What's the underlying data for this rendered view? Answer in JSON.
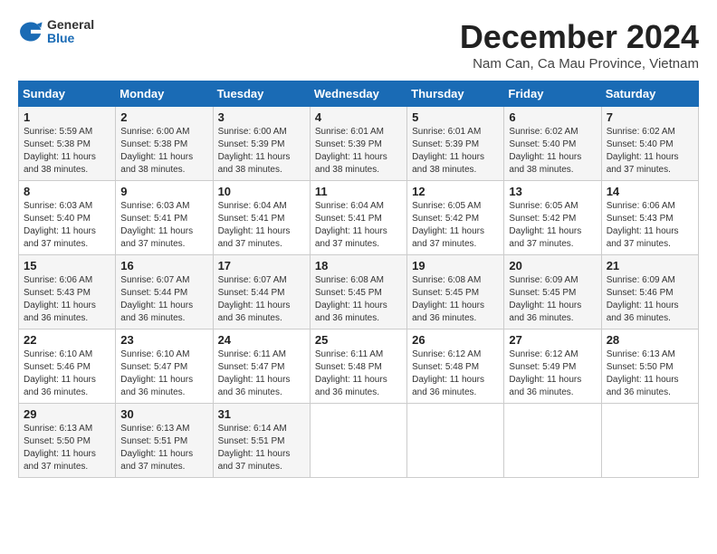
{
  "logo": {
    "general": "General",
    "blue": "Blue"
  },
  "title": "December 2024",
  "location": "Nam Can, Ca Mau Province, Vietnam",
  "headers": [
    "Sunday",
    "Monday",
    "Tuesday",
    "Wednesday",
    "Thursday",
    "Friday",
    "Saturday"
  ],
  "weeks": [
    [
      {
        "day": "1",
        "detail": "Sunrise: 5:59 AM\nSunset: 5:38 PM\nDaylight: 11 hours\nand 38 minutes."
      },
      {
        "day": "2",
        "detail": "Sunrise: 6:00 AM\nSunset: 5:38 PM\nDaylight: 11 hours\nand 38 minutes."
      },
      {
        "day": "3",
        "detail": "Sunrise: 6:00 AM\nSunset: 5:39 PM\nDaylight: 11 hours\nand 38 minutes."
      },
      {
        "day": "4",
        "detail": "Sunrise: 6:01 AM\nSunset: 5:39 PM\nDaylight: 11 hours\nand 38 minutes."
      },
      {
        "day": "5",
        "detail": "Sunrise: 6:01 AM\nSunset: 5:39 PM\nDaylight: 11 hours\nand 38 minutes."
      },
      {
        "day": "6",
        "detail": "Sunrise: 6:02 AM\nSunset: 5:40 PM\nDaylight: 11 hours\nand 38 minutes."
      },
      {
        "day": "7",
        "detail": "Sunrise: 6:02 AM\nSunset: 5:40 PM\nDaylight: 11 hours\nand 37 minutes."
      }
    ],
    [
      {
        "day": "8",
        "detail": "Sunrise: 6:03 AM\nSunset: 5:40 PM\nDaylight: 11 hours\nand 37 minutes."
      },
      {
        "day": "9",
        "detail": "Sunrise: 6:03 AM\nSunset: 5:41 PM\nDaylight: 11 hours\nand 37 minutes."
      },
      {
        "day": "10",
        "detail": "Sunrise: 6:04 AM\nSunset: 5:41 PM\nDaylight: 11 hours\nand 37 minutes."
      },
      {
        "day": "11",
        "detail": "Sunrise: 6:04 AM\nSunset: 5:41 PM\nDaylight: 11 hours\nand 37 minutes."
      },
      {
        "day": "12",
        "detail": "Sunrise: 6:05 AM\nSunset: 5:42 PM\nDaylight: 11 hours\nand 37 minutes."
      },
      {
        "day": "13",
        "detail": "Sunrise: 6:05 AM\nSunset: 5:42 PM\nDaylight: 11 hours\nand 37 minutes."
      },
      {
        "day": "14",
        "detail": "Sunrise: 6:06 AM\nSunset: 5:43 PM\nDaylight: 11 hours\nand 37 minutes."
      }
    ],
    [
      {
        "day": "15",
        "detail": "Sunrise: 6:06 AM\nSunset: 5:43 PM\nDaylight: 11 hours\nand 36 minutes."
      },
      {
        "day": "16",
        "detail": "Sunrise: 6:07 AM\nSunset: 5:44 PM\nDaylight: 11 hours\nand 36 minutes."
      },
      {
        "day": "17",
        "detail": "Sunrise: 6:07 AM\nSunset: 5:44 PM\nDaylight: 11 hours\nand 36 minutes."
      },
      {
        "day": "18",
        "detail": "Sunrise: 6:08 AM\nSunset: 5:45 PM\nDaylight: 11 hours\nand 36 minutes."
      },
      {
        "day": "19",
        "detail": "Sunrise: 6:08 AM\nSunset: 5:45 PM\nDaylight: 11 hours\nand 36 minutes."
      },
      {
        "day": "20",
        "detail": "Sunrise: 6:09 AM\nSunset: 5:45 PM\nDaylight: 11 hours\nand 36 minutes."
      },
      {
        "day": "21",
        "detail": "Sunrise: 6:09 AM\nSunset: 5:46 PM\nDaylight: 11 hours\nand 36 minutes."
      }
    ],
    [
      {
        "day": "22",
        "detail": "Sunrise: 6:10 AM\nSunset: 5:46 PM\nDaylight: 11 hours\nand 36 minutes."
      },
      {
        "day": "23",
        "detail": "Sunrise: 6:10 AM\nSunset: 5:47 PM\nDaylight: 11 hours\nand 36 minutes."
      },
      {
        "day": "24",
        "detail": "Sunrise: 6:11 AM\nSunset: 5:47 PM\nDaylight: 11 hours\nand 36 minutes."
      },
      {
        "day": "25",
        "detail": "Sunrise: 6:11 AM\nSunset: 5:48 PM\nDaylight: 11 hours\nand 36 minutes."
      },
      {
        "day": "26",
        "detail": "Sunrise: 6:12 AM\nSunset: 5:48 PM\nDaylight: 11 hours\nand 36 minutes."
      },
      {
        "day": "27",
        "detail": "Sunrise: 6:12 AM\nSunset: 5:49 PM\nDaylight: 11 hours\nand 36 minutes."
      },
      {
        "day": "28",
        "detail": "Sunrise: 6:13 AM\nSunset: 5:50 PM\nDaylight: 11 hours\nand 36 minutes."
      }
    ],
    [
      {
        "day": "29",
        "detail": "Sunrise: 6:13 AM\nSunset: 5:50 PM\nDaylight: 11 hours\nand 37 minutes."
      },
      {
        "day": "30",
        "detail": "Sunrise: 6:13 AM\nSunset: 5:51 PM\nDaylight: 11 hours\nand 37 minutes."
      },
      {
        "day": "31",
        "detail": "Sunrise: 6:14 AM\nSunset: 5:51 PM\nDaylight: 11 hours\nand 37 minutes."
      },
      {
        "day": "",
        "detail": ""
      },
      {
        "day": "",
        "detail": ""
      },
      {
        "day": "",
        "detail": ""
      },
      {
        "day": "",
        "detail": ""
      }
    ]
  ]
}
